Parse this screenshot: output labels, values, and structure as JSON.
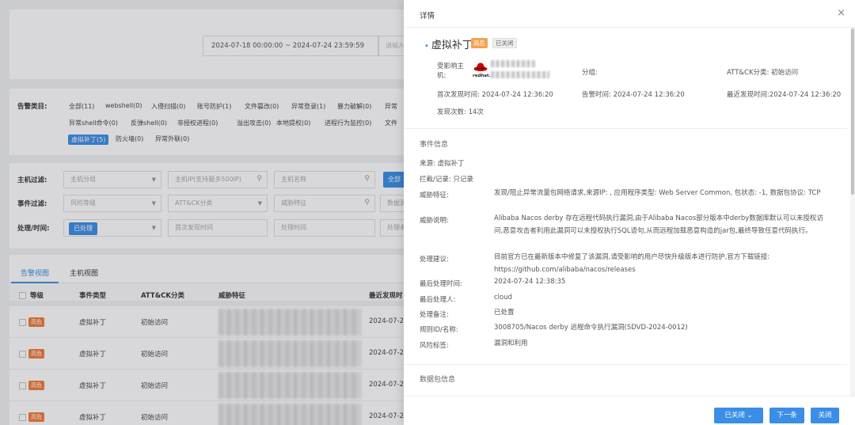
{
  "background": {
    "date_range": "2024-07-18 00:00:00 ~ 2024-07-24  23:59:59",
    "date_tail": "请输入",
    "alarm_type_label": "告警类目:",
    "alarm_types_row1": [
      "全部(11)",
      "webshell(0)",
      "入侵扫描(0)",
      "账号防护(1)",
      "文件篡改(0)",
      "异常登录(1)",
      "暴力破解(0)",
      "异常"
    ],
    "alarm_types_row2": [
      "异常shell命令(0)",
      "反弹shell(0)",
      "非授权进程(0)",
      "溢出攻击(0)",
      "本地提权(0)",
      "进程行为监控(0)",
      "文件"
    ],
    "alarm_types_row3": [
      "虚拟补丁(5)",
      "防火墙(0)",
      "异常外联(0)"
    ],
    "host_filter_label": "主机过滤:",
    "host_group": "主机分组",
    "host_ip": "主机IP(支持最多500IP)",
    "host_name": "主机名称",
    "host_all_btn": "全部",
    "event_filter_label": "事件过滤:",
    "risk_level": "风险等级",
    "attck": "ATT&CK分类",
    "threat_feature": "威胁特征",
    "data_source": "数据源",
    "process_label": "处理/时间:",
    "processed_btn": "已处理",
    "first_seen": "首次发现时间",
    "process_time": "处理时间",
    "processor": "处理者",
    "tabs": [
      "告警视图",
      "主机视图"
    ],
    "table_headers": [
      "等级",
      "事件类型",
      "ATT&CK分类",
      "威胁特征",
      "最近发现时"
    ],
    "rows": [
      {
        "level": "高危",
        "type": "虚拟补丁",
        "attck": "初始访问",
        "time": "2024-07-24"
      },
      {
        "level": "高危",
        "type": "虚拟补丁",
        "attck": "初始访问",
        "time": "2024-07-2"
      },
      {
        "level": "高危",
        "type": "虚拟补丁",
        "attck": "初始访问",
        "time": "2024-07-2"
      },
      {
        "level": "高危",
        "type": "虚拟补丁",
        "attck": "初始访问",
        "time": "2024-07-2"
      }
    ]
  },
  "drawer": {
    "title": "详情",
    "event_title": "虚拟补丁",
    "tag_high": "高危",
    "tag_closed": "已关闭",
    "affected_host_label": "受影响主机:",
    "redhat_text": "redhat.",
    "group_label": "分组:",
    "attck_label": "ATT&CK分类: 初始访问",
    "first_seen": "首次发现时间: 2024-07-24 12:36:20",
    "alarm_time": "告警时间: 2024-07-24 12:36:20",
    "last_seen": "最近发现时间:2024-07-24 12:36:20",
    "count": "发现次数: 14次",
    "event_info_header": "事件信息",
    "source": "来源: 虚拟补丁",
    "intercept": "拦截/记录: 只记录",
    "threat_label": "威胁特征:",
    "threat_value": "发现/阻止异常流量包网络请求,来源IP:  , 应用程序类型: Web Server Common, 包状态: -1, 数据包协议: TCP",
    "desc_label": "威胁说明:",
    "desc_value": "Alibaba Nacos derby 存在远程代码执行漏洞,由于Alibaba Nacos部分版本中derby数据库默认可以未授权访问,恶意攻击者利用此漏洞可以未授权执行SQL语句,从而远程加载恶意构造的jar包,最终导致任意代码执行。",
    "advice_label": "处理建议:",
    "advice_value": "目前官方已在最新版本中修复了该漏洞,请受影响的用户尽快升级版本进行防护,官方下载链接: https://github.com/alibaba/nacos/releases",
    "last_process_time_label": "最后处理时间:",
    "last_process_time": "2024-07-24 12:38:35",
    "last_processor_label": "最后处理人:",
    "last_processor": "cloud",
    "process_note_label": "处理备注:",
    "process_note": "已处置",
    "rule_label": "规则ID/名称:",
    "rule_value": "3008705/Nacos derby 远程命令执行漏洞(SDVD-2024-0012)",
    "risk_tag_label": "风险标签:",
    "risk_tag": "漏洞和利用",
    "packet_info_header": "数据包信息",
    "btn_closed": "已关闭",
    "btn_next": "下一条",
    "btn_close": "关闭"
  },
  "colors": {
    "accent": "#3a8ee6",
    "high": "#f27c3a"
  }
}
